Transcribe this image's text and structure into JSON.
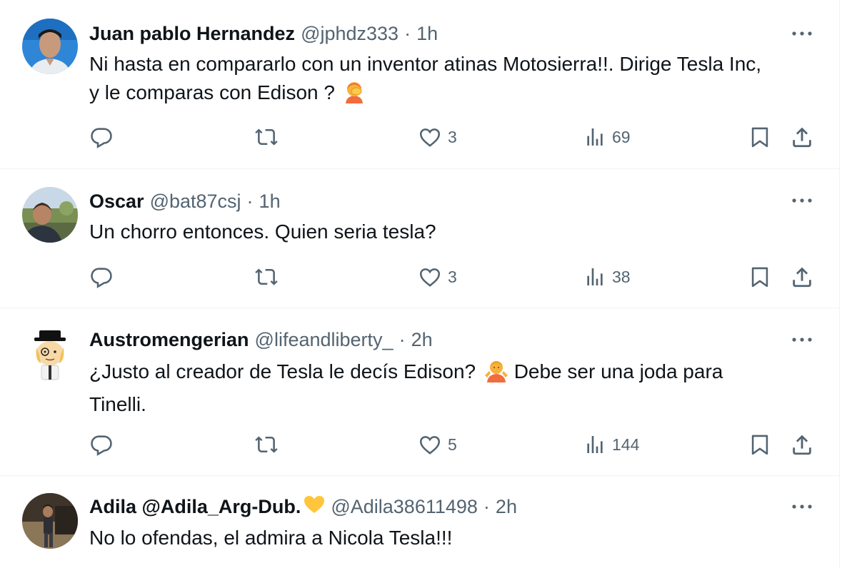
{
  "tweets": [
    {
      "name": "Juan pablo Hernandez",
      "handle": "@jphdz333",
      "separator": "·",
      "time": "1h",
      "text_lines": [
        "Ni hasta en compararlo con un inventor atinas Motosierra!!. Dirige Tesla Inc,",
        "y le comparas con Edison ?"
      ],
      "emoji": "face-palm-emoji",
      "likes": "3",
      "views": "69"
    },
    {
      "name": "Oscar",
      "handle": "@bat87csj",
      "separator": "·",
      "time": "1h",
      "text_lines": [
        "Un chorro entonces. Quien seria tesla?"
      ],
      "likes": "3",
      "views": "38"
    },
    {
      "name": "Austromengerian",
      "handle": "@lifeandliberty_",
      "separator": "·",
      "time": "2h",
      "text_lines": [
        "¿Justo al creador de Tesla le decís Edison?",
        "Debe ser una joda para",
        "Tinelli."
      ],
      "emoji": "person-shrugging-emoji",
      "likes": "5",
      "views": "144"
    },
    {
      "name": "Adila @Adila_Arg-Dub.",
      "name_emoji": "yellow-heart-emoji",
      "handle": "@Adila38611498",
      "separator": "·",
      "time": "2h",
      "text_lines": [
        "No lo ofendas, el admira a Nicola Tesla!!!"
      ]
    }
  ],
  "icons": {
    "reply": "reply-icon",
    "retweet": "retweet-icon",
    "like": "heart-icon",
    "views": "views-icon",
    "bookmark": "bookmark-icon",
    "share": "share-icon",
    "more": "more-icon"
  },
  "colors": {
    "text": "#0f1419",
    "secondary": "#536471",
    "divider": "#eff3f4"
  }
}
